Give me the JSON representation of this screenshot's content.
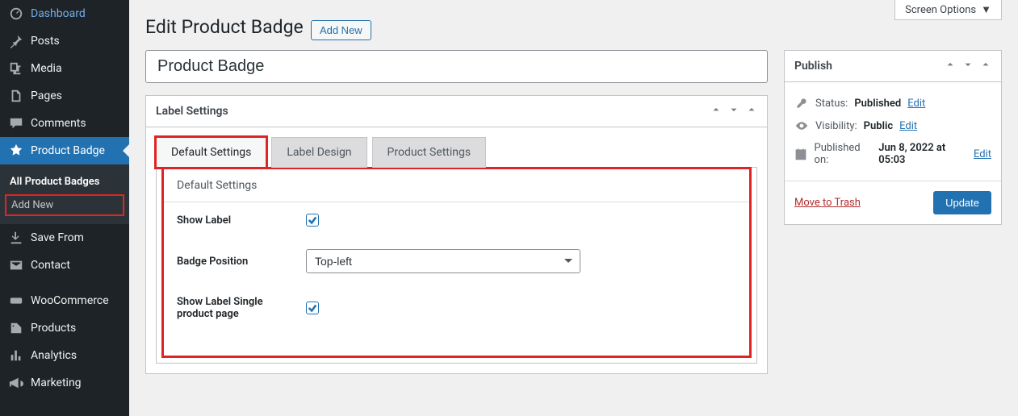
{
  "sidebar": {
    "items": [
      {
        "icon": "dashboard",
        "label": "Dashboard"
      },
      {
        "icon": "pin",
        "label": "Posts"
      },
      {
        "icon": "media",
        "label": "Media"
      },
      {
        "icon": "page",
        "label": "Pages"
      },
      {
        "icon": "comment",
        "label": "Comments"
      },
      {
        "icon": "badge",
        "label": "Product Badge",
        "active": true
      },
      {
        "icon": "save",
        "label": "Save From"
      },
      {
        "icon": "mail",
        "label": "Contact"
      },
      {
        "icon": "woo",
        "label": "WooCommerce"
      },
      {
        "icon": "product",
        "label": "Products"
      },
      {
        "icon": "chart",
        "label": "Analytics"
      },
      {
        "icon": "megaphone",
        "label": "Marketing"
      }
    ],
    "submenu": [
      {
        "label": "All Product Badges",
        "current": true
      },
      {
        "label": "Add New",
        "highlight": true
      }
    ]
  },
  "header": {
    "screen_options": "Screen Options",
    "page_title": "Edit Product Badge",
    "add_new": "Add New"
  },
  "editor": {
    "title_value": "Product Badge"
  },
  "metabox": {
    "label": "Label Settings",
    "tabs": [
      {
        "label": "Default Settings",
        "active": true,
        "hl": true
      },
      {
        "label": "Label Design"
      },
      {
        "label": "Product Settings"
      }
    ],
    "panel_title": "Default Settings",
    "fields": {
      "show_label": {
        "label": "Show Label",
        "checked": true
      },
      "badge_position": {
        "label": "Badge Position",
        "value": "Top-left"
      },
      "show_label_single": {
        "label": "Show Label Single product page",
        "checked": true
      }
    }
  },
  "publish": {
    "box_title": "Publish",
    "status_label": "Status:",
    "status_value": "Published",
    "visibility_label": "Visibility:",
    "visibility_value": "Public",
    "date_label": "Published on:",
    "date_value": "Jun 8, 2022 at 05:03",
    "edit": "Edit",
    "trash": "Move to Trash",
    "update": "Update"
  }
}
